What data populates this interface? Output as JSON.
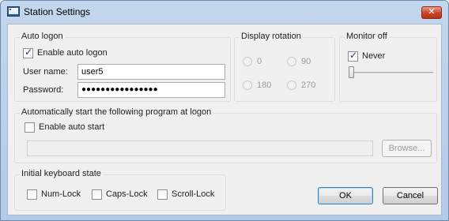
{
  "window": {
    "title": "Station Settings",
    "close_glyph": "✕"
  },
  "auto_logon": {
    "group_title": "Auto logon",
    "enable_label": "Enable auto logon",
    "enable_checked": true,
    "username_label": "User name:",
    "username_value": "user5",
    "password_label": "Password:",
    "password_value": "●●●●●●●●●●●●●●●●"
  },
  "display_rotation": {
    "group_title": "Display rotation",
    "options": [
      "0",
      "90",
      "180",
      "270"
    ]
  },
  "monitor_off": {
    "group_title": "Monitor off",
    "never_label": "Never",
    "never_checked": true,
    "slider_level": 0
  },
  "auto_start": {
    "group_title": "Automatically start the following program at logon",
    "enable_label": "Enable auto start",
    "enable_checked": false,
    "program_value": "",
    "browse_label": "Browse..."
  },
  "keyboard": {
    "group_title": "Initial keyboard state",
    "num_lock": "Num-Lock",
    "caps_lock": "Caps-Lock",
    "scroll_lock": "Scroll-Lock"
  },
  "buttons": {
    "ok": "OK",
    "cancel": "Cancel"
  }
}
